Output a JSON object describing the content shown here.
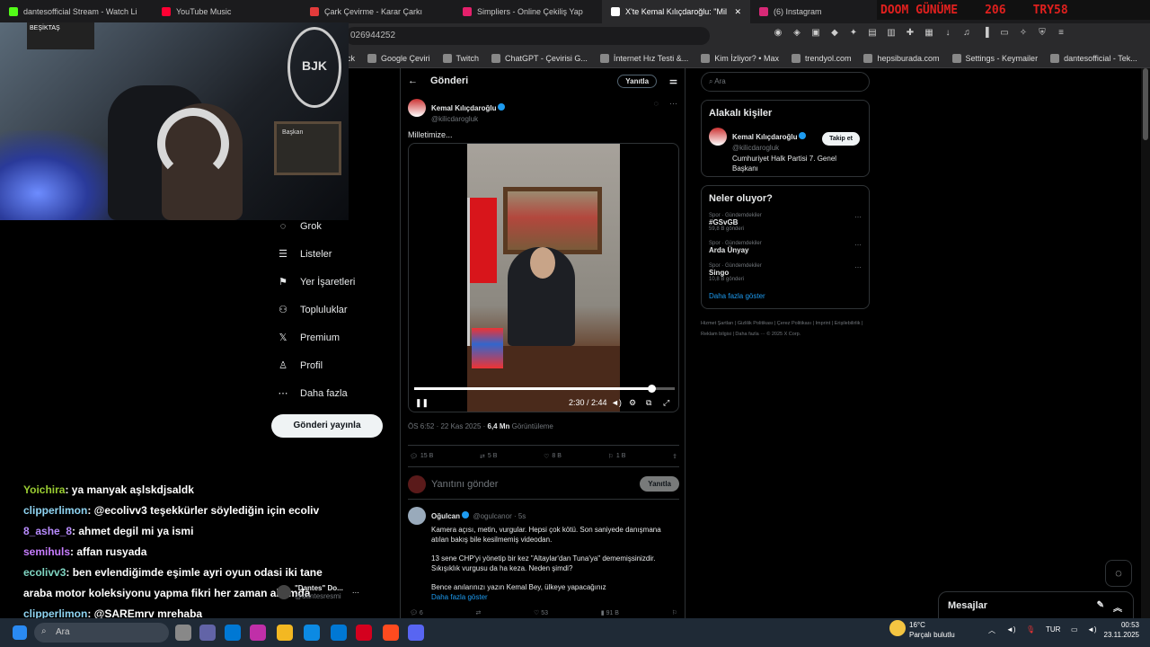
{
  "tabs": [
    {
      "label": "dantesofficial Stream - Watch Li",
      "color": "#53fc18"
    },
    {
      "label": "YouTube Music",
      "color": "#ff0033"
    },
    {
      "label": "Çark Çevirme - Karar Çarkı",
      "color": "#e23b3b"
    },
    {
      "label": "Simpliers - Online Çekiliş Yap",
      "color": "#e4206b"
    },
    {
      "label": "X'te Kemal Kılıçdaroğlu: \"Mil",
      "color": "#ffffff"
    },
    {
      "label": "(6) Instagram",
      "color": "#d62976"
    }
  ],
  "overlay": {
    "doom_label": "DOOM GÜNÜME",
    "doom_count": "206",
    "doom_code": "TRY58"
  },
  "url": "026944252",
  "bookmarks": [
    "ck",
    "Google Çeviri",
    "Twitch",
    "ChatGPT - Çevirisi G...",
    "İnternet Hız Testi &...",
    "Kim İzliyor? • Max",
    "trendyol.com",
    "hepsiburada.com",
    "Settings - Keymailer",
    "dantesofficial - Tek..."
  ],
  "webcam": {
    "tv_text": "BEŞİKTAŞ",
    "board_text": "Başkan"
  },
  "nav": [
    {
      "label": "Grok",
      "icon": "grok-icon",
      "glyph": "◌"
    },
    {
      "label": "Listeler",
      "icon": "list-icon",
      "glyph": "☰"
    },
    {
      "label": "Yer İşaretleri",
      "icon": "bookmark-icon",
      "glyph": "⚑"
    },
    {
      "label": "Topluluklar",
      "icon": "communities-icon",
      "glyph": "⚇"
    },
    {
      "label": "Premium",
      "icon": "x-logo-icon",
      "glyph": "𝕏"
    },
    {
      "label": "Profil",
      "icon": "profile-icon",
      "glyph": "♙"
    },
    {
      "label": "Daha fazla",
      "icon": "more-circle-icon",
      "glyph": "⋯"
    }
  ],
  "post_button": "Gönderi yayınla",
  "chat": [
    {
      "user": "Yoichira",
      "color": "#9acd32",
      "msg": ": ya manyak aşlskdjsaldk"
    },
    {
      "user": "clipperlimon",
      "color": "#8fd4f2",
      "msg": ": @ecolivv3 teşekkürler söylediğin için ecoliv"
    },
    {
      "user": "8_ashe_8",
      "color": "#b98cff",
      "msg": ": ahmet degil mi ya ismi"
    },
    {
      "user": "semihuls",
      "color": "#c77dff",
      "msg": ": affan rusyada"
    },
    {
      "user": "ecolivv3",
      "color": "#7fd4c1",
      "msg": ": ben evlendiğimde eşimle ayri oyun odasi iki tane"
    },
    {
      "user": "",
      "color": "#ffffff",
      "msg": "araba motor koleksiyonu yapma fikri her zaman aklımda"
    },
    {
      "user": "clipperlimon",
      "color": "#8fd4f2",
      "msg": ": @SAREmrv mrehaba"
    }
  ],
  "mini_profile": {
    "name": "\"Dantes\" Do...",
    "handle": "@dantesresmi"
  },
  "main": {
    "title": "Gönderi",
    "reply_pill": "Yanıtla",
    "author": "Kemal Kılıçdaroğlu",
    "handle": "@kilicdarogluk",
    "text": "Milletimize...",
    "video_time": "2:30 / 2:44",
    "video_progress": 0.91,
    "meta_time": "ÖS 6:52 · 22 Kas 2025 · ",
    "meta_views": "6,4 Mn",
    "meta_views_label": " Görüntüleme",
    "counts": {
      "replies": "15 B",
      "reposts": "5 B",
      "likes": "8 B",
      "bookmarks": "1 B"
    },
    "reply_placeholder": "Yanıtını gönder",
    "reply_button": "Yanıtla"
  },
  "reply": {
    "name": "Oğulcan",
    "handle": "@ogulcanor · 5s",
    "p1": "Kamera açısı, metin, vurgular. Hepsi çok kötü. Son saniyede danışmana atılan bakış bile kesilmemiş videodan.",
    "p2": "13 sene CHP'yi yönetip bir kez \"Altaylar'dan Tuna'ya\" dememişsinizdir. Sıkışıklık vurgusu da ha keza. Neden şimdi?",
    "p3": "Bence anılarınızı yazın Kemal Bey, ülkeye yapacağınız",
    "more": "Daha fazla göster",
    "counts": {
      "replies": "6",
      "reposts": "",
      "likes": "53",
      "views": "91 B"
    }
  },
  "right": {
    "search_placeholder": "Ara",
    "related_title": "Alakalı kişiler",
    "person": {
      "name": "Kemal Kılıçdaroğlu",
      "handle": "@kilicdarogluk",
      "bio": "Cumhuriyet Halk Partisi 7. Genel Başkanı",
      "follow": "Takip et"
    },
    "trends_title": "Neler oluyor?",
    "trends": [
      {
        "cat": "Spor · Gündemdekiler",
        "name": "#GSvGB",
        "count": "59,8 B gönderi"
      },
      {
        "cat": "Spor · Gündemdekiler",
        "name": "Arda Ünyay",
        "count": ""
      },
      {
        "cat": "Spor · Gündemdekiler",
        "name": "Singo",
        "count": "10,8 B gönderi"
      }
    ],
    "show_more": "Daha fazla göster",
    "footer": "Hizmet Şartları | Gizlilik Politikası | Çerez Politikası | Imprint | Erişilebilirlik | Reklam bilgisi | Daha fazla ··· © 2025 X Corp."
  },
  "messages_label": "Mesajlar",
  "taskbar": {
    "search": "Ara",
    "weather_temp": "16°C",
    "weather_desc": "Parçalı bulutlu",
    "lang": "TUR",
    "time": "00:53",
    "date": "23.11.2025"
  }
}
